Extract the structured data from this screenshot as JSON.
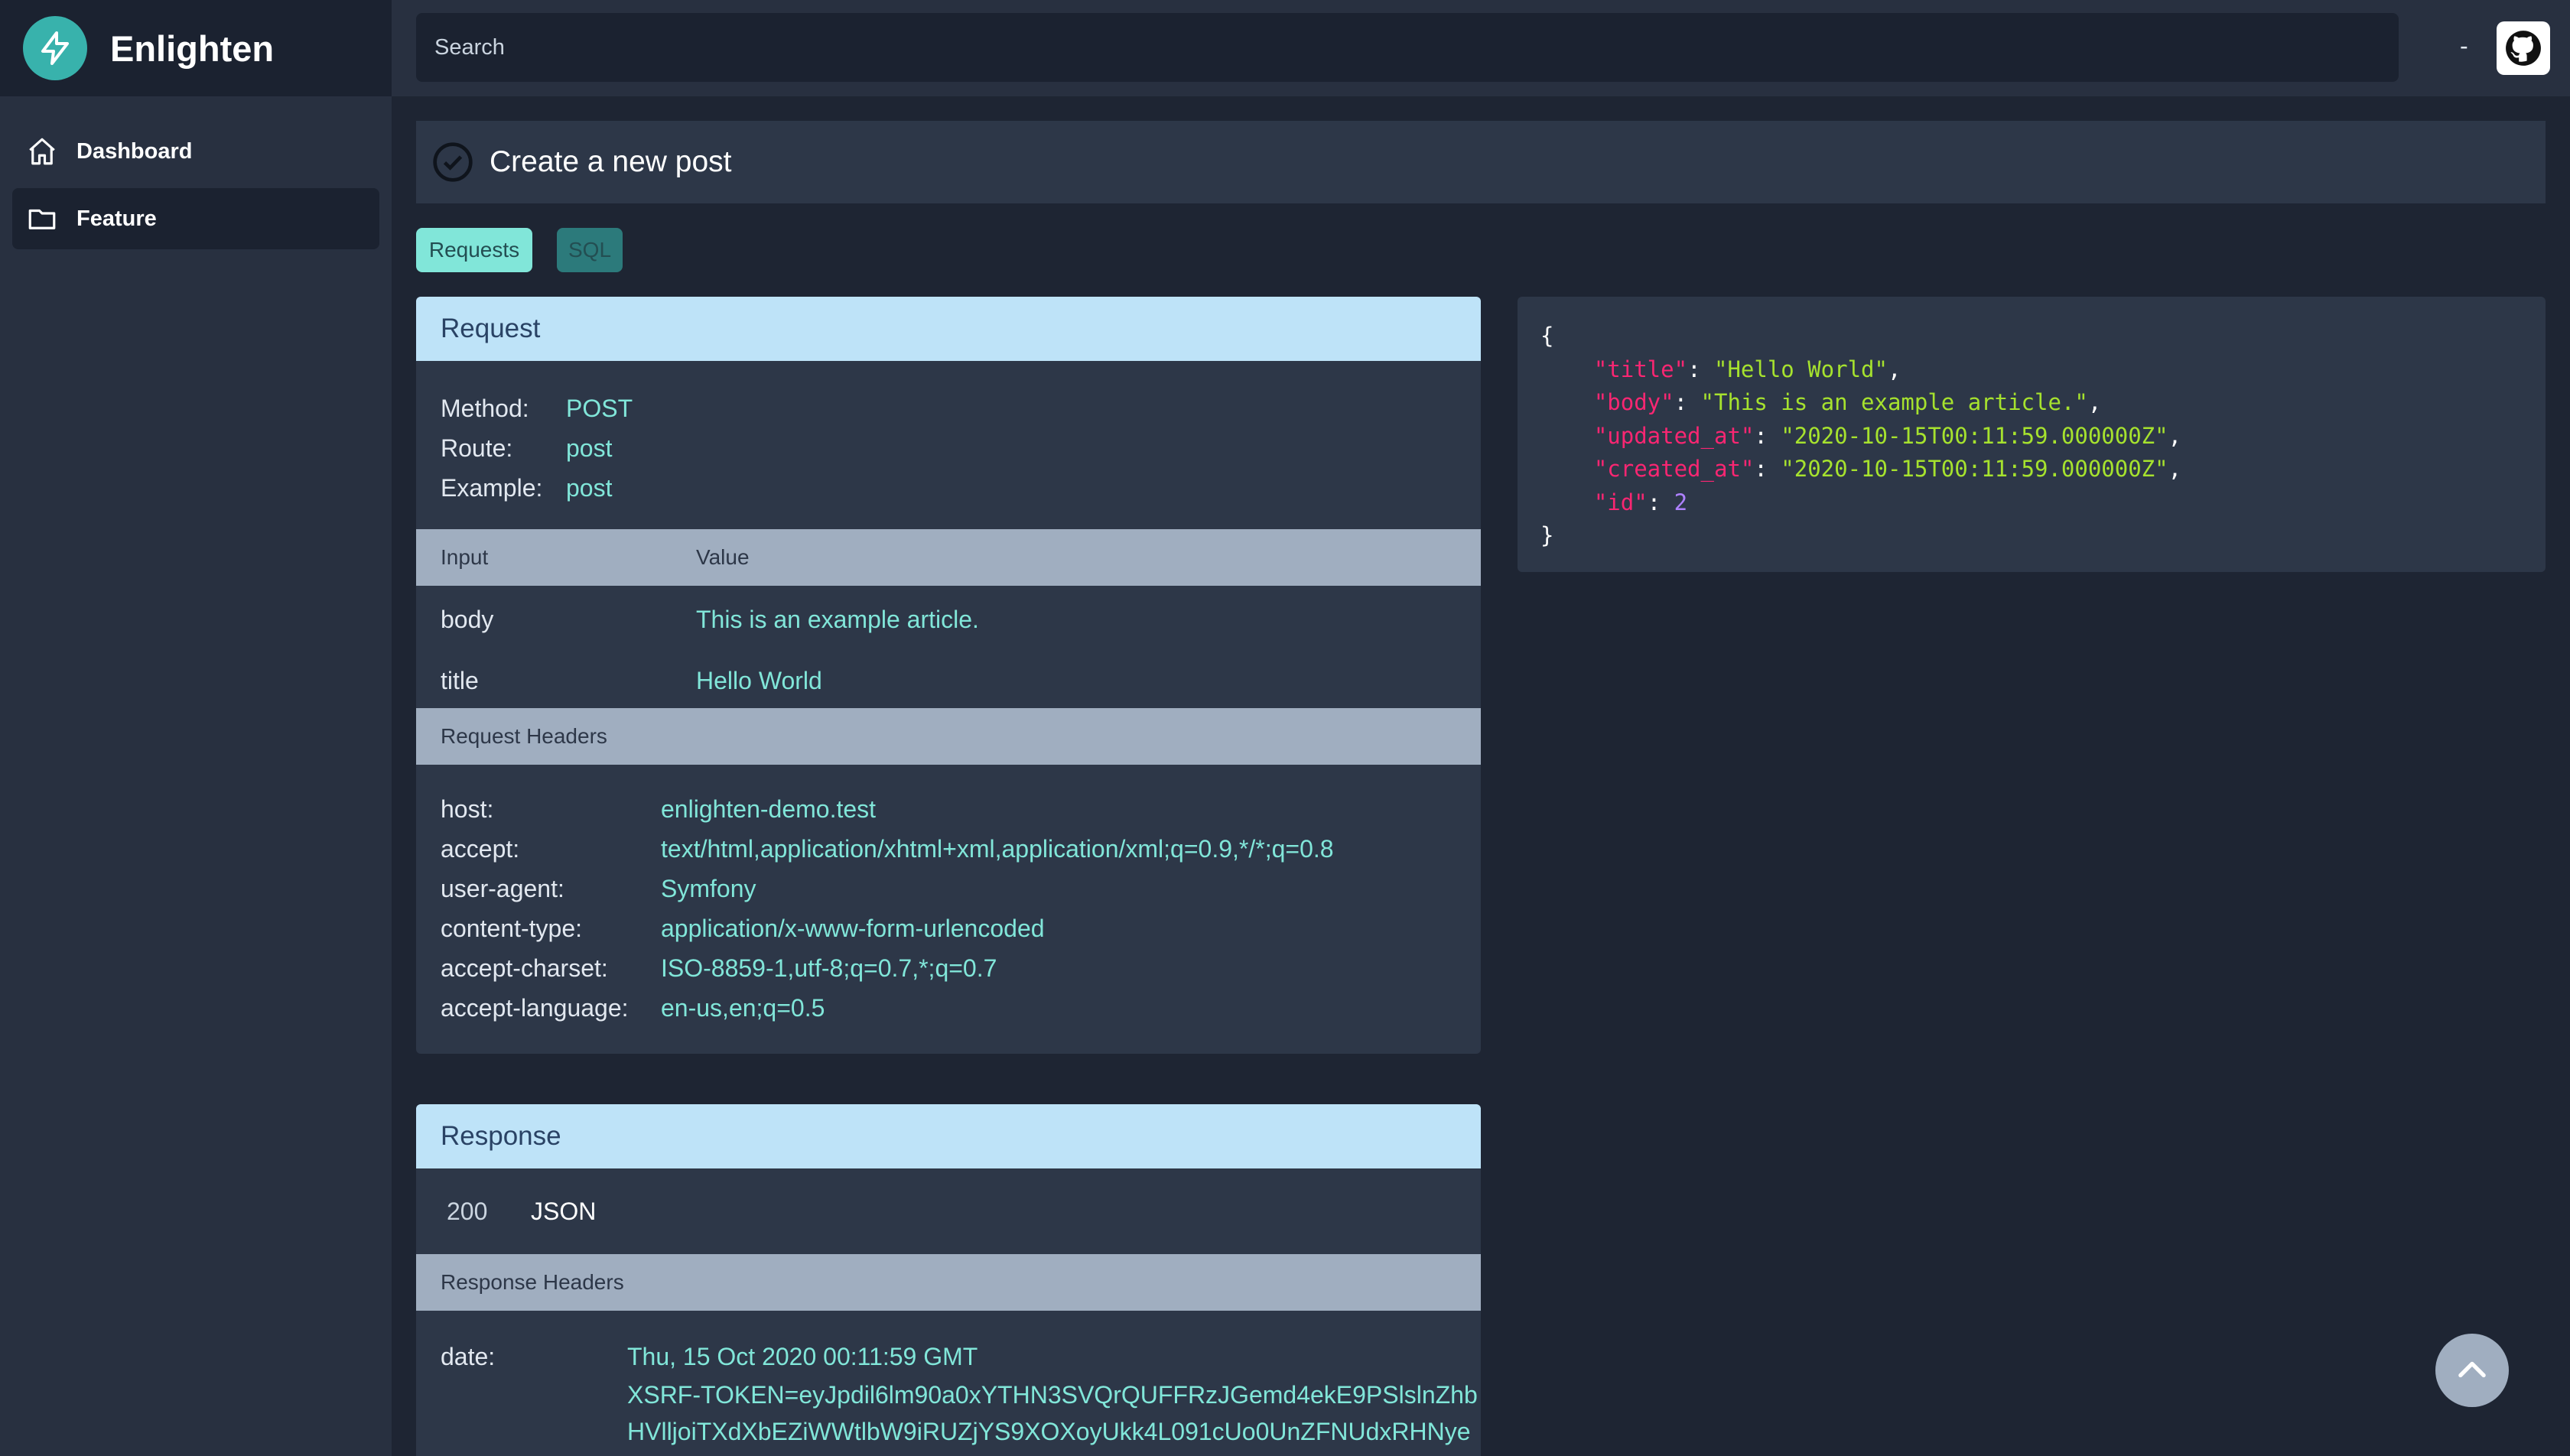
{
  "app": {
    "name": "Enlighten"
  },
  "sidebar": {
    "items": [
      {
        "label": "Dashboard",
        "icon": "home-icon"
      },
      {
        "label": "Feature",
        "icon": "folder-icon",
        "active": true
      }
    ]
  },
  "header": {
    "search_placeholder": "Search",
    "user_text": "-",
    "github_icon": "github-icon"
  },
  "page": {
    "title": "Create a new post",
    "title_icon": "check-circle-icon"
  },
  "tabs": [
    {
      "label": "Requests",
      "active": true
    },
    {
      "label": "SQL",
      "active": false
    }
  ],
  "request": {
    "heading": "Request",
    "info": [
      {
        "key": "Method:",
        "value": "POST"
      },
      {
        "key": "Route:",
        "value": "post"
      },
      {
        "key": "Example:",
        "value": "post"
      }
    ],
    "input_table": {
      "columns": [
        "Input",
        "Value"
      ],
      "rows": [
        {
          "input": "body",
          "value": "This is an example article."
        },
        {
          "input": "title",
          "value": "Hello World"
        }
      ]
    },
    "headers_title": "Request Headers",
    "headers": [
      {
        "key": "host:",
        "value": "enlighten-demo.test"
      },
      {
        "key": "accept:",
        "value": "text/html,application/xhtml+xml,application/xml;q=0.9,*/*;q=0.8"
      },
      {
        "key": "user-agent:",
        "value": "Symfony"
      },
      {
        "key": "content-type:",
        "value": "application/x-www-form-urlencoded"
      },
      {
        "key": "accept-charset:",
        "value": "ISO-8859-1,utf-8;q=0.7,*;q=0.7"
      },
      {
        "key": "accept-language:",
        "value": "en-us,en;q=0.5"
      }
    ]
  },
  "response": {
    "heading": "Response",
    "status": "200",
    "format": "JSON",
    "headers_title": "Response Headers",
    "headers": [
      {
        "key": "date:",
        "value": "Thu, 15 Oct 2020 00:11:59 GMT"
      },
      {
        "key": "",
        "value": "XSRF-TOKEN=eyJpdil6lm90a0xYTHN3SVQrQUFFRzJGemd4ekE9PSlslnZhb"
      },
      {
        "key": "",
        "value": "HVlljoiTXdXbEZiWWtlbW9iRUZjYS9XOXoyUkk4L091cUo0UnZFNUdxRHNye"
      }
    ]
  },
  "response_json": {
    "open": "{",
    "close": "}",
    "fields": [
      {
        "key": "\"title\"",
        "value": "\"Hello World\"",
        "type": "string",
        "comma": ","
      },
      {
        "key": "\"body\"",
        "value": "\"This is an example article.\"",
        "type": "string",
        "comma": ","
      },
      {
        "key": "\"updated_at\"",
        "value": "\"2020-10-15T00:11:59.000000Z\"",
        "type": "string",
        "comma": ","
      },
      {
        "key": "\"created_at\"",
        "value": "\"2020-10-15T00:11:59.000000Z\"",
        "type": "string",
        "comma": ","
      },
      {
        "key": "\"id\"",
        "value": "2",
        "type": "number",
        "comma": ""
      }
    ]
  },
  "scroll_top_icon": "chevron-up-icon"
}
